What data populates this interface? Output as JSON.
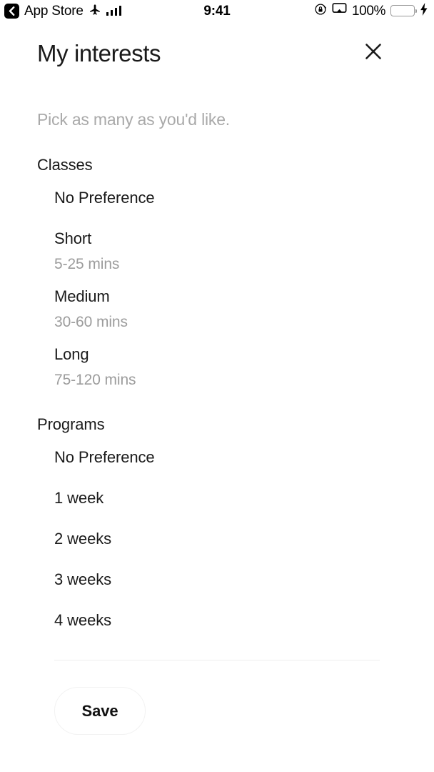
{
  "status_bar": {
    "back_label": "App Store",
    "back_icon": "chevron-left-icon",
    "airplane_icon": "airplane-mode-icon",
    "signal_icon": "cellular-signal-icon",
    "time": "9:41",
    "rotation_lock_icon": "rotation-lock-icon",
    "airplay_icon": "screen-mirroring-icon",
    "battery_percent": "100%",
    "battery_icon": "battery-icon",
    "charging_icon": "charging-bolt-icon",
    "battery_color": "#4ddc63"
  },
  "header": {
    "title": "My interests",
    "close_icon": "close-icon"
  },
  "content": {
    "subtitle": "Pick as many as you'd like.",
    "sections": [
      {
        "title": "Classes",
        "options": [
          {
            "label": "No Preference",
            "sub": ""
          },
          {
            "label": "Short",
            "sub": "5-25 mins"
          },
          {
            "label": "Medium",
            "sub": "30-60 mins"
          },
          {
            "label": "Long",
            "sub": "75-120 mins"
          }
        ]
      },
      {
        "title": "Programs",
        "options": [
          {
            "label": "No Preference",
            "sub": ""
          },
          {
            "label": "1 week",
            "sub": ""
          },
          {
            "label": "2 weeks",
            "sub": ""
          },
          {
            "label": "3 weeks",
            "sub": ""
          },
          {
            "label": "4 weeks",
            "sub": ""
          }
        ]
      }
    ]
  },
  "footer": {
    "save_label": "Save"
  }
}
